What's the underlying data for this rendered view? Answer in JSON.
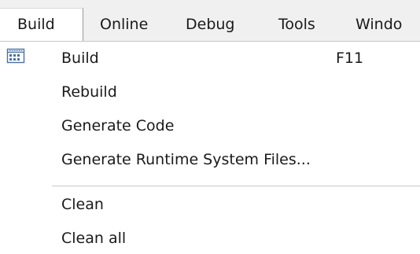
{
  "menubar": {
    "items": [
      {
        "label": "Build"
      },
      {
        "label": "Online"
      },
      {
        "label": "Debug"
      },
      {
        "label": "Tools"
      },
      {
        "label": "Windo"
      }
    ]
  },
  "build_menu": {
    "icon": "build-icon",
    "items": [
      {
        "label": "Build",
        "shortcut": "F11"
      },
      {
        "label": "Rebuild"
      },
      {
        "label": "Generate Code"
      },
      {
        "label": "Generate Runtime System Files..."
      },
      {
        "label": "Clean"
      },
      {
        "label": "Clean all"
      }
    ]
  }
}
